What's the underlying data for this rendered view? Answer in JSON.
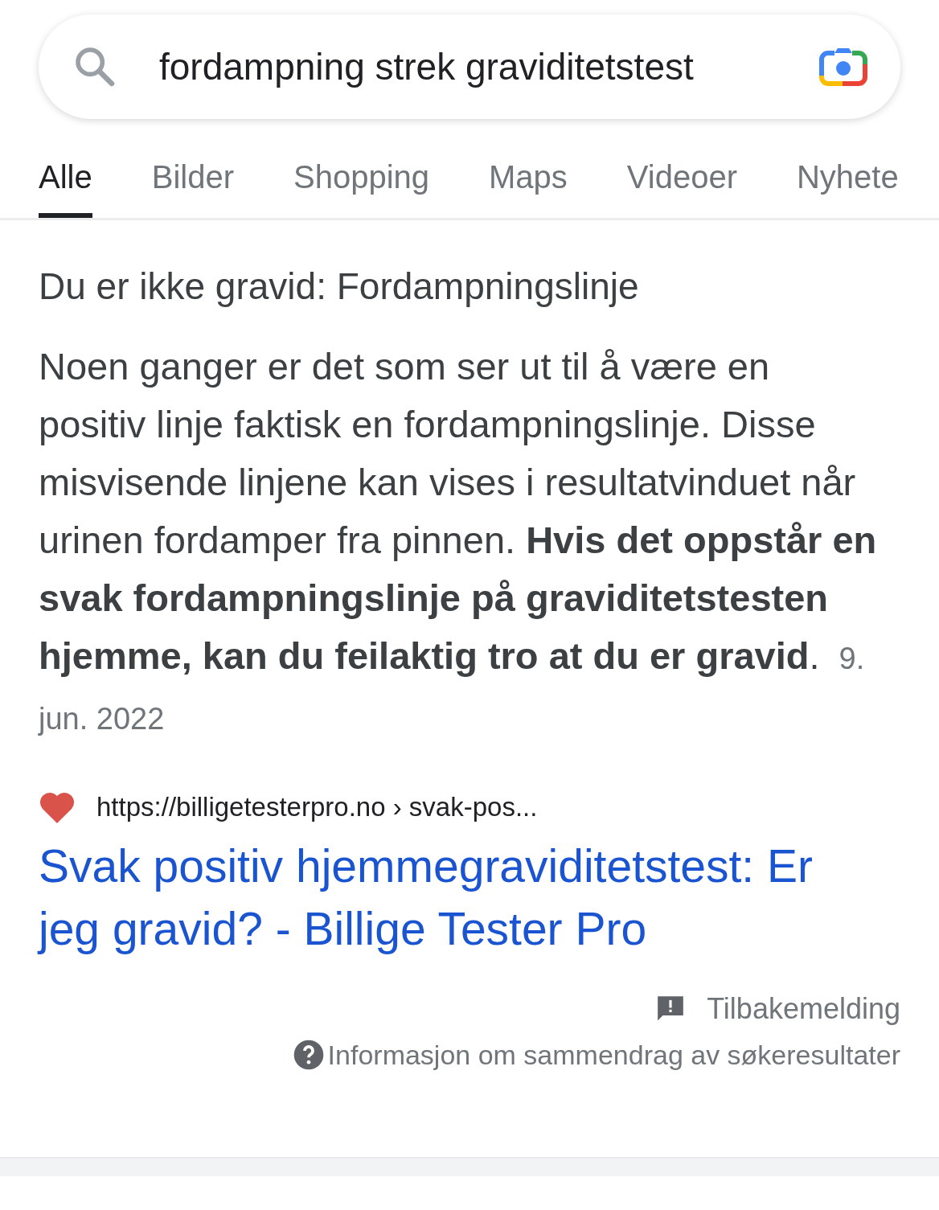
{
  "search": {
    "value": "fordampning strek graviditetstest"
  },
  "tabs": [
    {
      "label": "Alle",
      "selected": true
    },
    {
      "label": "Bilder",
      "selected": false
    },
    {
      "label": "Shopping",
      "selected": false
    },
    {
      "label": "Maps",
      "selected": false
    },
    {
      "label": "Videoer",
      "selected": false
    },
    {
      "label": "Nyhete",
      "selected": false
    }
  ],
  "snippet": {
    "heading": "Du er ikke gravid: Fordampningslinje",
    "text": "Noen ganger er det som ser ut til å være en positiv linje faktisk en fordampningslinje. Disse misvisende linjene kan vises i resultatvinduet når urinen fordamper fra pinnen. **Hvis det oppstår en svak fordampningslinje på graviditetstesten hjemme, kan du feilaktig tro at du er gravid**.",
    "date": "9. jun. 2022"
  },
  "source": {
    "url": "https://billigetesterpro.no › svak-pos...",
    "title": "Svak positiv hjemmegraviditetstest: Er jeg gravid? - Billige Tester Pro"
  },
  "footer": {
    "feedback": "Tilbakemelding",
    "info": "Informasjon om sammendrag av søkeresultater"
  }
}
